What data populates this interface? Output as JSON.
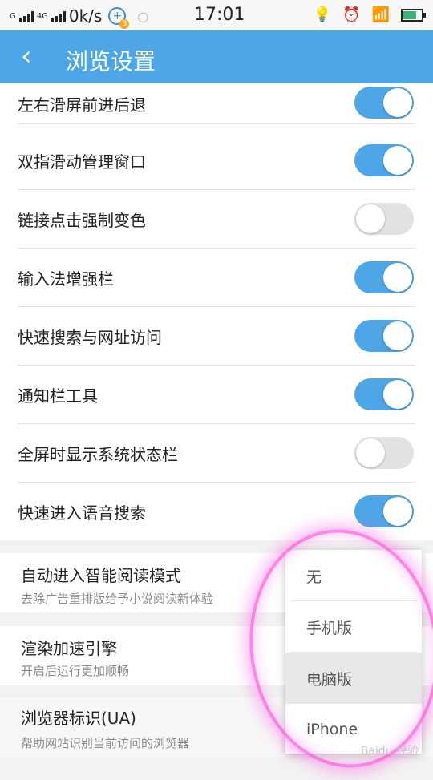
{
  "status": {
    "net1": "G",
    "net2": "4G",
    "speed": "0k/s",
    "badge": "3",
    "time": "17:01",
    "icons": [
      "bulb-icon",
      "alarm-icon",
      "wifi-icon",
      "battery-icon"
    ]
  },
  "header": {
    "back_icon": "‹",
    "title": "浏览设置"
  },
  "settings": [
    {
      "label": "左右滑屏前进后退",
      "on": true
    },
    {
      "label": "双指滑动管理窗口",
      "on": true
    },
    {
      "label": "链接点击强制变色",
      "on": false
    },
    {
      "label": "输入法增强栏",
      "on": true
    },
    {
      "label": "快速搜索与网址访问",
      "on": true
    },
    {
      "label": "通知栏工具",
      "on": true
    },
    {
      "label": "全屏时显示系统状态栏",
      "on": false
    },
    {
      "label": "快速进入语音搜索",
      "on": true
    }
  ],
  "sections": [
    {
      "title": "自动进入智能阅读模式",
      "subtitle": "去除广告重排版给予小说阅读新体验"
    },
    {
      "title": "渲染加速引擎",
      "subtitle": "开启后运行更加顺畅"
    },
    {
      "title": "浏览器标识(UA)",
      "subtitle": "帮助网站识别当前访问的浏览器"
    }
  ],
  "ua_dropdown": {
    "options": [
      "无",
      "手机版",
      "电脑版",
      "iPhone"
    ],
    "selected_index": 2
  },
  "watermark": "Baidu 经验"
}
